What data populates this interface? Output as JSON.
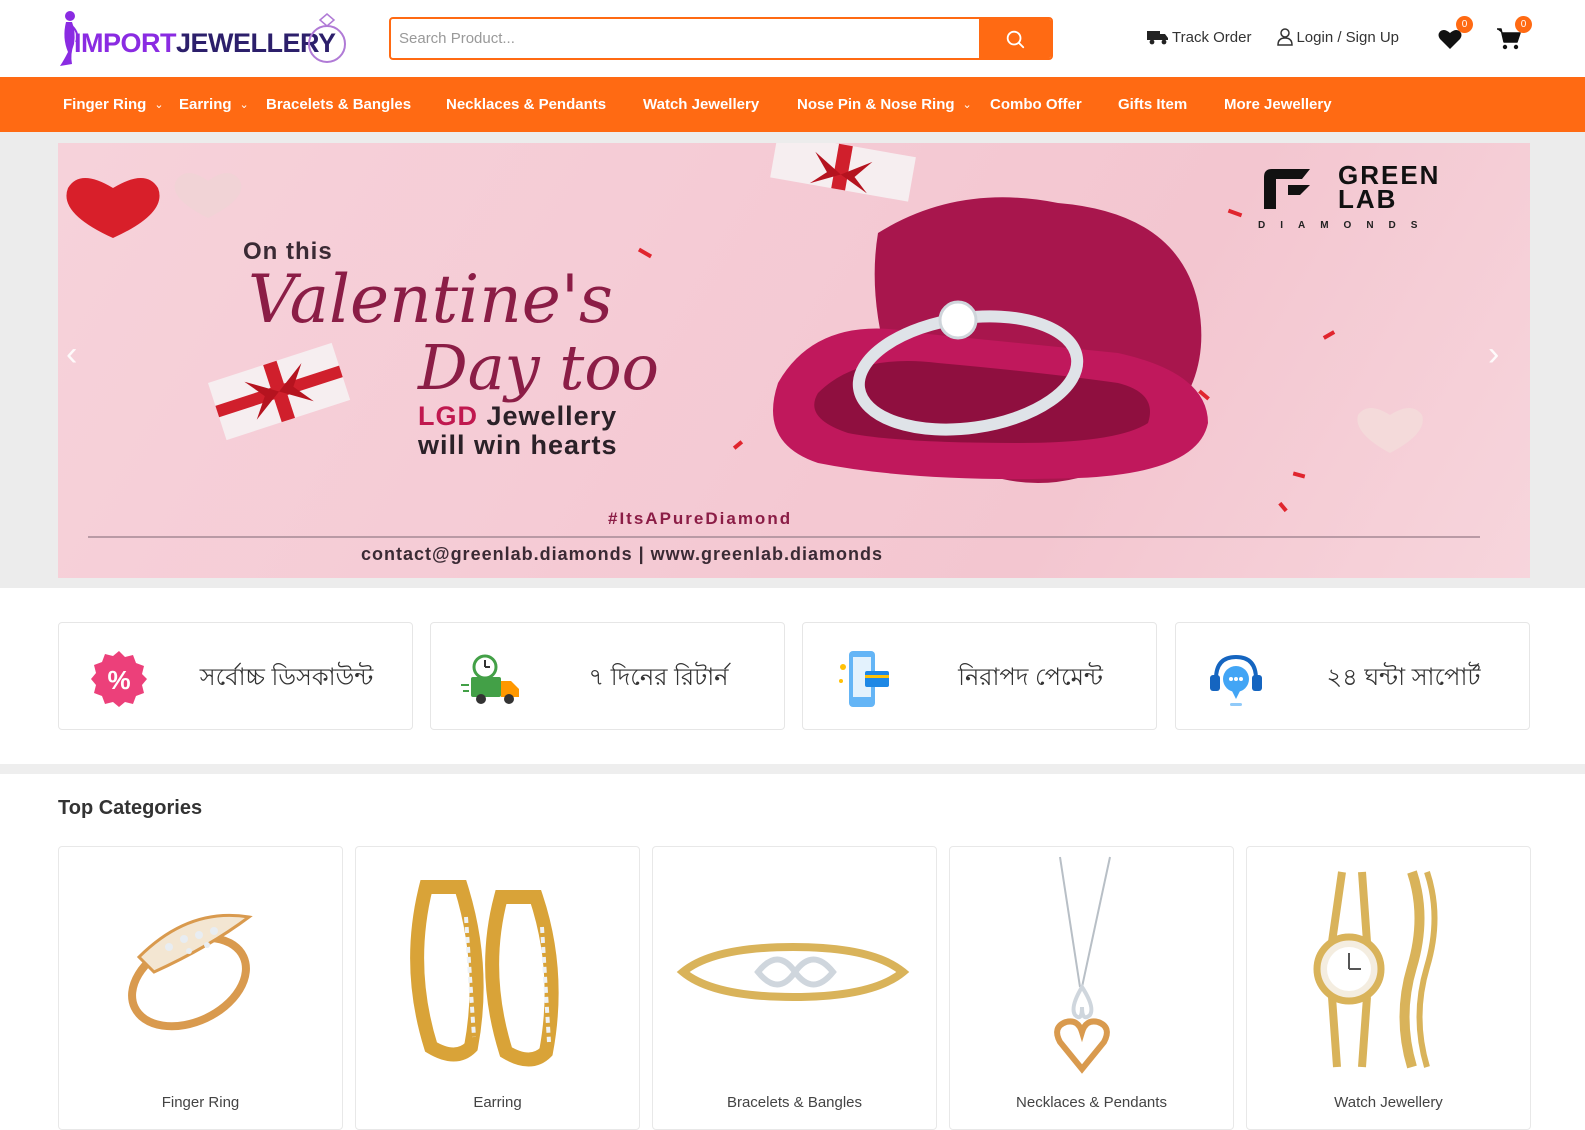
{
  "header": {
    "logo": {
      "part1": "IMPORT",
      "part2": "JEWELLERY"
    },
    "search": {
      "placeholder": "Search Product..."
    },
    "track_order": "Track Order",
    "login": "Login / Sign Up",
    "wishlist_count": "0",
    "cart_count": "0"
  },
  "nav": [
    {
      "label": "Finger Ring",
      "has_dropdown": true
    },
    {
      "label": "Earring",
      "has_dropdown": true
    },
    {
      "label": "Bracelets & Bangles",
      "has_dropdown": false
    },
    {
      "label": "Necklaces & Pendants",
      "has_dropdown": false
    },
    {
      "label": "Watch Jewellery",
      "has_dropdown": false
    },
    {
      "label": "Nose Pin & Nose Ring",
      "has_dropdown": true
    },
    {
      "label": "Combo Offer",
      "has_dropdown": false
    },
    {
      "label": "Gifts Item",
      "has_dropdown": false
    },
    {
      "label": "More Jewellery",
      "has_dropdown": false
    }
  ],
  "hero": {
    "line1": "On this",
    "script1": "Valentine's",
    "script2": "Day too",
    "lgd": "LGD",
    "line2_rest": "Jewellery",
    "line3": "will win hearts",
    "hashtag": "#ItsAPureDiamond",
    "contact": "contact@greenlab.diamonds  |  www.greenlab.diamonds",
    "brand_name": "GREEN LAB",
    "brand_sub": "DIAMONDS"
  },
  "features": [
    {
      "text": "সর্বোচ্চ ডিসকাউন্ট",
      "icon": "discount-icon"
    },
    {
      "text": "৭ দিনের রিটার্ন",
      "icon": "delivery-truck-icon"
    },
    {
      "text": "নিরাপদ পেমেন্ট",
      "icon": "secure-payment-icon"
    },
    {
      "text": "২৪ ঘন্টা সাপোর্ট",
      "icon": "support-icon"
    }
  ],
  "top_categories": {
    "title": "Top Categories",
    "items": [
      {
        "label": "Finger Ring"
      },
      {
        "label": "Earring"
      },
      {
        "label": "Bracelets & Bangles"
      },
      {
        "label": "Necklaces & Pendants"
      },
      {
        "label": "Watch Jewellery"
      }
    ]
  },
  "colors": {
    "accent": "#ff6a13",
    "brand_purple": "#8a2be2"
  }
}
